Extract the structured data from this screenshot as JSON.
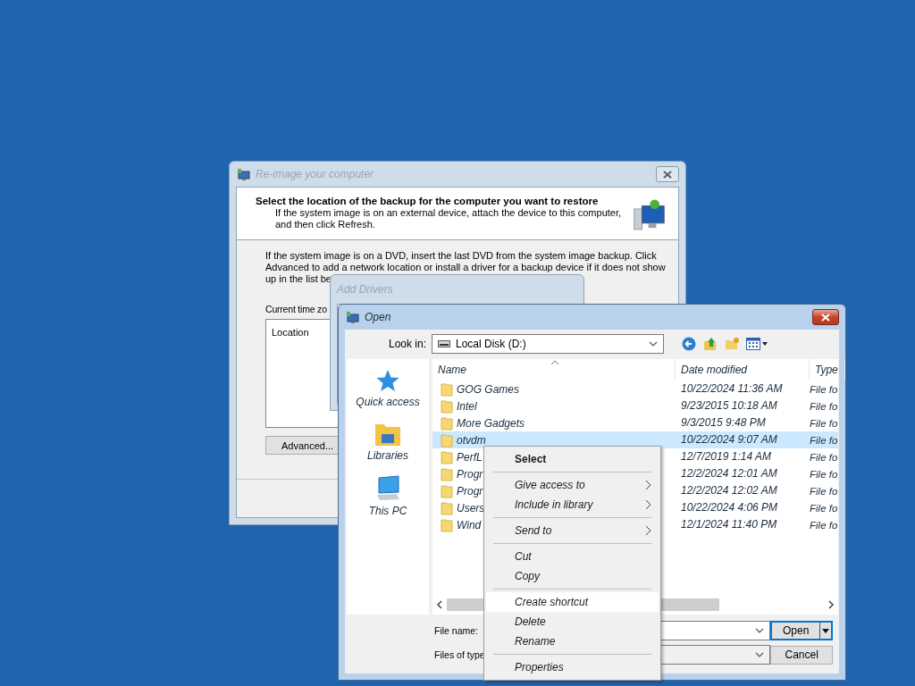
{
  "windows": [
    {
      "kind": "reimage",
      "active": false,
      "title": "Re-image your computer",
      "heading": "Select the location of the backup for the computer you want to restore",
      "subtext": "If the system image is on an external device, attach the device to this computer, and then click Refresh.",
      "body_lines": [
        "If the system image is on a DVD, insert the last DVD from the system image backup. Click",
        "Advanced to add a network location or install a driver for a backup device if it does not show",
        "up in the list be"
      ],
      "time_zone_label": "Current time zo",
      "list_column": "Location",
      "button": "Advanced..."
    },
    {
      "kind": "blank",
      "active": false,
      "title": "Add Drivers"
    },
    {
      "kind": "open",
      "active": true,
      "title": "Open",
      "look_in_label": "Look in:",
      "look_in_value": "Local Disk (D:)",
      "places": [
        {
          "kind": "star",
          "label": "Quick access"
        },
        {
          "kind": "libraries",
          "label": "Libraries"
        },
        {
          "kind": "pc",
          "label": "This PC"
        }
      ],
      "columns": [
        "Name",
        "Date modified",
        "Type"
      ],
      "rows": [
        {
          "name": "GOG Games",
          "date": "10/22/2024 11:36 AM",
          "type": "File fo",
          "selected": false
        },
        {
          "name": "Intel",
          "date": "9/23/2015 10:18 AM",
          "type": "File fo",
          "selected": false
        },
        {
          "name": "More Gadgets",
          "date": "9/3/2015 9:48 PM",
          "type": "File fo",
          "selected": false
        },
        {
          "name": "otvdm",
          "date": "10/22/2024 9:07 AM",
          "type": "File fo",
          "selected": true
        },
        {
          "name": "PerfL",
          "date": "12/7/2019 1:14 AM",
          "type": "File fo",
          "selected": false
        },
        {
          "name": "Progr",
          "date": "12/2/2024 12:01 AM",
          "type": "File fo",
          "selected": false
        },
        {
          "name": "Progr",
          "date": "12/2/2024 12:02 AM",
          "type": "File fo",
          "selected": false
        },
        {
          "name": "Users",
          "date": "10/22/2024 4:06 PM",
          "type": "File fo",
          "selected": false
        },
        {
          "name": "Wind",
          "date": "12/1/2024 11:40 PM",
          "type": "File fo",
          "selected": false
        }
      ],
      "file_name_label": "File name:",
      "file_type_label": "Files of type",
      "open_button": "Open",
      "cancel_button": "Cancel"
    }
  ],
  "context_menu": [
    {
      "kind": "item",
      "label": "Select",
      "default": true,
      "submenu": false,
      "selected": false
    },
    {
      "kind": "separator"
    },
    {
      "kind": "item",
      "label": "Give access to",
      "default": false,
      "submenu": true,
      "selected": false
    },
    {
      "kind": "item",
      "label": "Include in library",
      "default": false,
      "submenu": true,
      "selected": false
    },
    {
      "kind": "separator"
    },
    {
      "kind": "item",
      "label": "Send to",
      "default": false,
      "submenu": true,
      "selected": false
    },
    {
      "kind": "separator"
    },
    {
      "kind": "item",
      "label": "Cut",
      "default": false,
      "submenu": false,
      "selected": false
    },
    {
      "kind": "item",
      "label": "Copy",
      "default": false,
      "submenu": false,
      "selected": false
    },
    {
      "kind": "separator"
    },
    {
      "kind": "item",
      "label": "Create shortcut",
      "default": false,
      "submenu": false,
      "selected": true
    },
    {
      "kind": "item",
      "label": "Delete",
      "default": false,
      "submenu": false,
      "selected": false
    },
    {
      "kind": "item",
      "label": "Rename",
      "default": false,
      "submenu": false,
      "selected": false
    },
    {
      "kind": "separator"
    },
    {
      "kind": "item",
      "label": "Properties",
      "default": false,
      "submenu": false,
      "selected": false
    }
  ]
}
